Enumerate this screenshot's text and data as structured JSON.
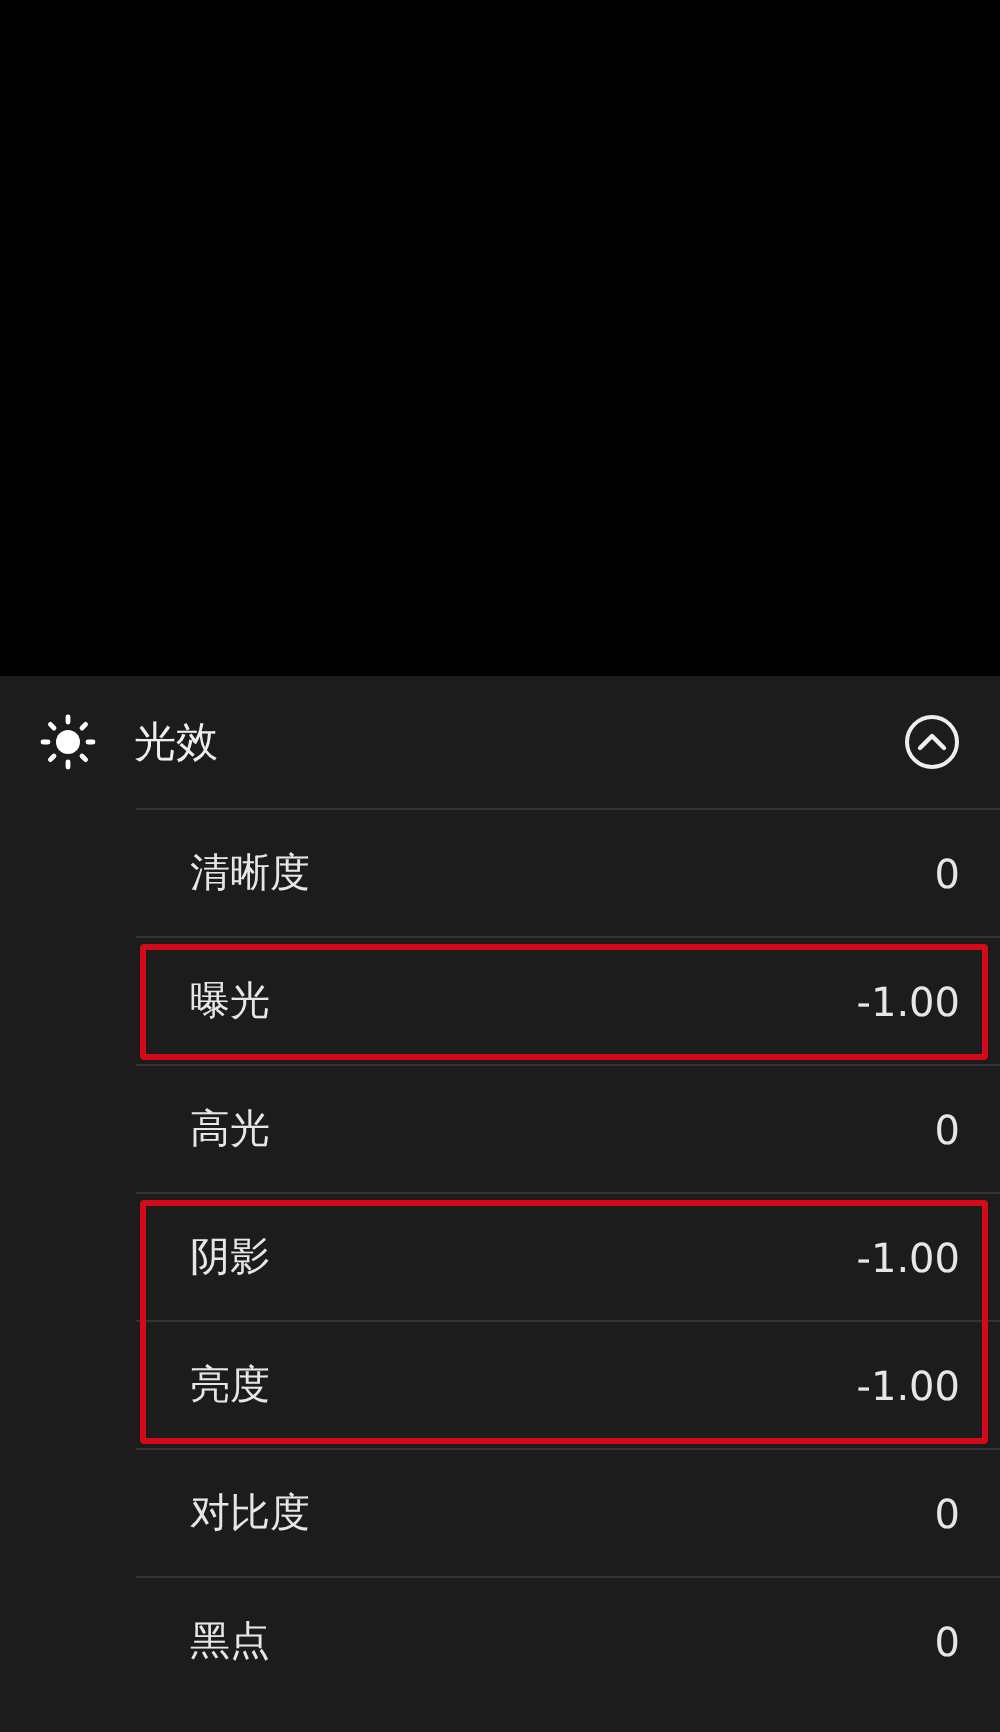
{
  "section": {
    "title": "光效",
    "expanded": true
  },
  "groups": [
    {
      "outlined": false,
      "rows": [
        {
          "label": "清晰度",
          "value": "0"
        }
      ]
    },
    {
      "outlined": true,
      "rows": [
        {
          "label": "曝光",
          "value": "-1.00"
        }
      ]
    },
    {
      "outlined": false,
      "rows": [
        {
          "label": "高光",
          "value": "0"
        }
      ]
    },
    {
      "outlined": true,
      "rows": [
        {
          "label": "阴影",
          "value": "-1.00"
        },
        {
          "label": "亮度",
          "value": "-1.00"
        }
      ]
    },
    {
      "outlined": false,
      "rows": [
        {
          "label": "对比度",
          "value": "0"
        },
        {
          "label": "黑点",
          "value": "0"
        }
      ]
    }
  ]
}
